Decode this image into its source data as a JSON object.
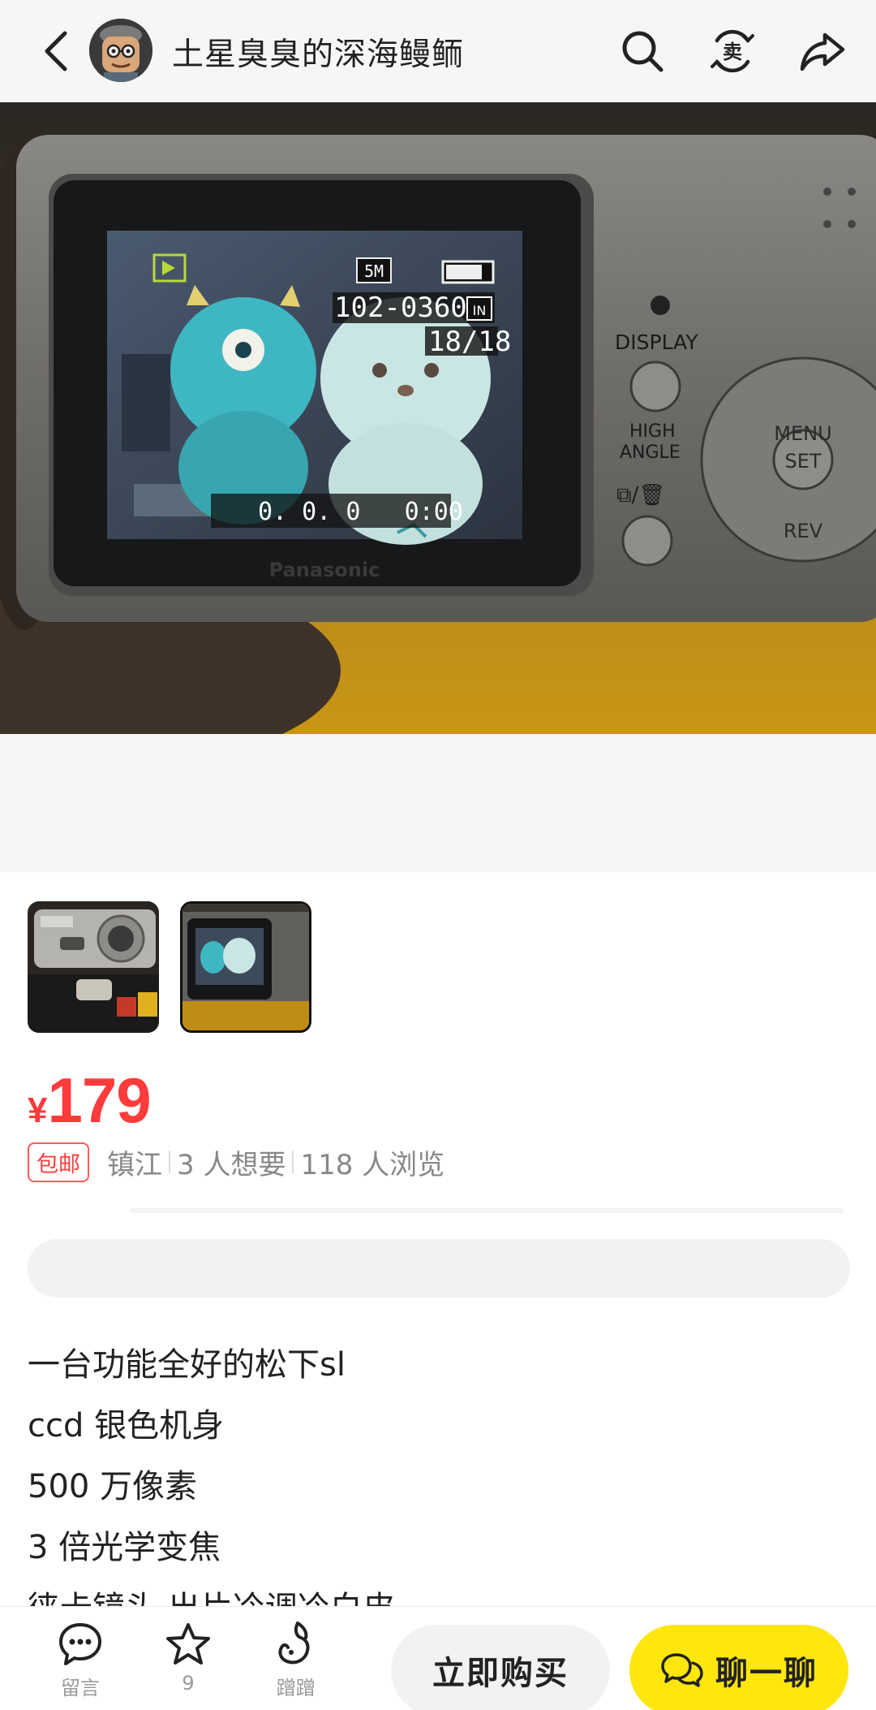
{
  "header": {
    "seller_name": "土星臭臭的深海鳗鲕",
    "icons": [
      "back-icon",
      "search-icon",
      "sell-icon",
      "share-icon"
    ]
  },
  "main_photo": {
    "brand_text": "Panasonic",
    "lcd": {
      "resolution": "5M",
      "file_number": "102-0360",
      "memory_label": "IN",
      "counter": "18/18",
      "date_time": "0. 0. 0   0:00"
    },
    "buttons": {
      "display": "DISPLAY",
      "high": "HIGH",
      "angle": "ANGLE",
      "menu": "MENU",
      "set": "SET",
      "rev": "REV"
    }
  },
  "thumbnails": [
    {
      "name": "photo-1",
      "selected": false
    },
    {
      "name": "photo-2",
      "selected": true
    }
  ],
  "price": {
    "currency": "¥",
    "amount": "179"
  },
  "meta": {
    "tag": "包邮",
    "location": "镇江",
    "wants": "3 人想要",
    "views": "118 人浏览"
  },
  "description": [
    "一台功能全好的松下sl",
    "ccd 银色机身",
    "500 万像素",
    "3 倍光学变焦",
    "徕卡镜头 出片冷调冷白皮"
  ],
  "bottom_bar": {
    "comment_label": "留言",
    "favorite_count": "9",
    "nudge_label": "蹭蹭",
    "buy_label": "立即购买",
    "chat_label": "聊一聊"
  },
  "colors": {
    "price_red": "#ff3b3b",
    "chat_yellow": "#ffe60f"
  }
}
